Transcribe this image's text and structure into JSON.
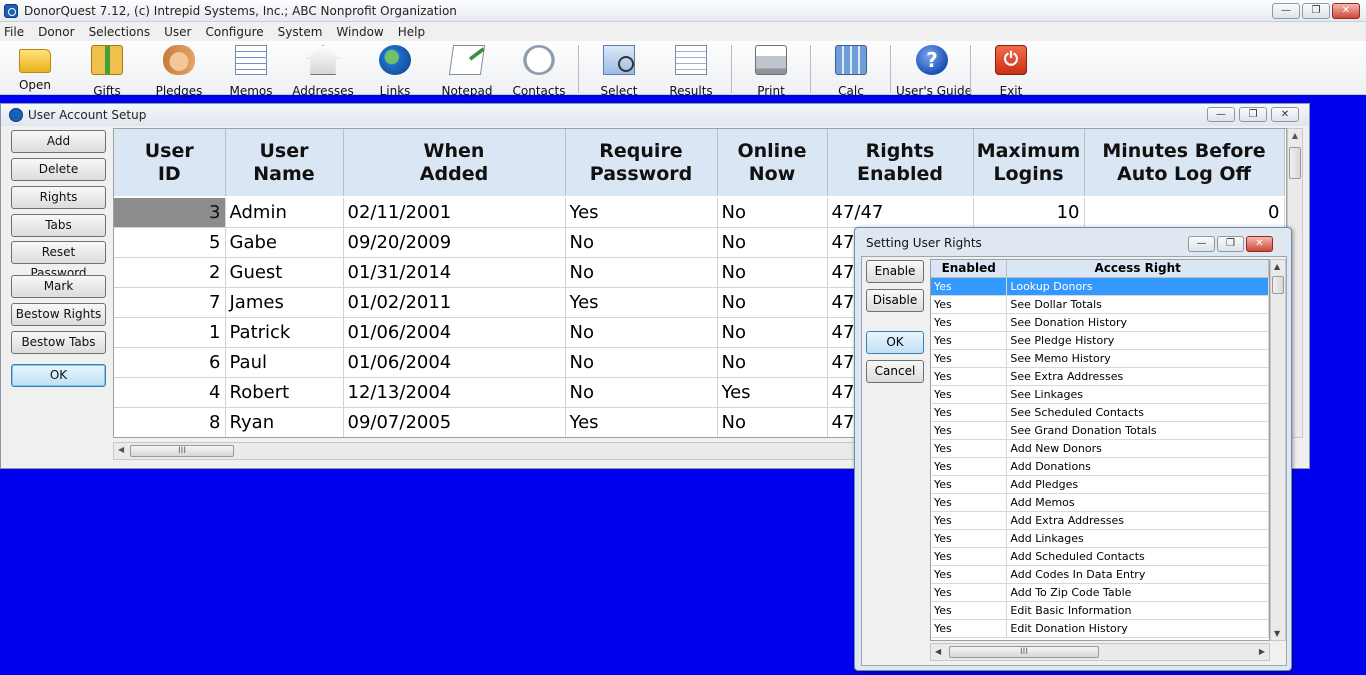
{
  "app": {
    "title": "DonorQuest 7.12, (c) Intrepid Systems, Inc.; ABC Nonprofit Organization",
    "window_buttons": [
      "—",
      "❐",
      "✕"
    ]
  },
  "menu": [
    "File",
    "Donor",
    "Selections",
    "User",
    "Configure",
    "System",
    "Window",
    "Help"
  ],
  "toolbar": [
    {
      "label": "Open",
      "icon": "folder-icon"
    },
    {
      "label": "Gifts",
      "icon": "gift-icon"
    },
    {
      "label": "Pledges",
      "icon": "handshake-icon"
    },
    {
      "label": "Memos",
      "icon": "memo-icon"
    },
    {
      "label": "Addresses",
      "icon": "house-icon"
    },
    {
      "label": "Links",
      "icon": "globe-icon"
    },
    {
      "label": "Notepad",
      "icon": "notepad-icon"
    },
    {
      "label": "Contacts",
      "icon": "clock-icon"
    },
    {
      "label": "Select",
      "icon": "magnifier-icon"
    },
    {
      "label": "Results",
      "icon": "results-icon"
    },
    {
      "label": "Print",
      "icon": "printer-icon"
    },
    {
      "label": "Calc",
      "icon": "calculator-icon"
    },
    {
      "label": "User's Guide",
      "icon": "help-icon"
    },
    {
      "label": "Exit",
      "icon": "exit-icon"
    }
  ],
  "user_account_setup": {
    "title": "User Account Setup",
    "buttons": [
      "Add",
      "Delete",
      "Rights",
      "Tabs",
      "Reset Password",
      "Mark",
      "Bestow Rights",
      "Bestow Tabs",
      "OK"
    ],
    "columns": [
      "User\nID",
      "User\nName",
      "When\nAdded",
      "Require\nPassword",
      "Online\nNow",
      "Rights\nEnabled",
      "Maximum\nLogins",
      "Minutes Before\nAuto Log Off"
    ],
    "rows": [
      [
        "3",
        "Admin",
        "02/11/2001",
        "Yes",
        "No",
        "47/47",
        "10",
        "0"
      ],
      [
        "5",
        "Gabe",
        "09/20/2009",
        "No",
        "No",
        "47/",
        "",
        ""
      ],
      [
        "2",
        "Guest",
        "01/31/2014",
        "No",
        "No",
        "47/",
        "",
        ""
      ],
      [
        "7",
        "James",
        "01/02/2011",
        "Yes",
        "No",
        "47/",
        "",
        ""
      ],
      [
        "1",
        "Patrick",
        "01/06/2004",
        "No",
        "No",
        "47/",
        "",
        ""
      ],
      [
        "6",
        "Paul",
        "01/06/2004",
        "No",
        "No",
        "47/",
        "",
        ""
      ],
      [
        "4",
        "Robert",
        "12/13/2004",
        "No",
        "Yes",
        "47/",
        "",
        ""
      ],
      [
        "8",
        "Ryan",
        "09/07/2005",
        "Yes",
        "No",
        "47/",
        "",
        ""
      ]
    ],
    "scroll_thumb": "III"
  },
  "rights_dialog": {
    "title": "Setting User Rights",
    "buttons": [
      "Enable",
      "Disable",
      "OK",
      "Cancel"
    ],
    "columns": [
      "Enabled",
      "Access Right"
    ],
    "rows": [
      [
        "Yes",
        "Lookup Donors"
      ],
      [
        "Yes",
        "See Dollar Totals"
      ],
      [
        "Yes",
        "See Donation History"
      ],
      [
        "Yes",
        "See Pledge History"
      ],
      [
        "Yes",
        "See Memo History"
      ],
      [
        "Yes",
        "See Extra Addresses"
      ],
      [
        "Yes",
        "See Linkages"
      ],
      [
        "Yes",
        "See Scheduled Contacts"
      ],
      [
        "Yes",
        "See Grand Donation Totals"
      ],
      [
        "Yes",
        "Add New Donors"
      ],
      [
        "Yes",
        "Add Donations"
      ],
      [
        "Yes",
        "Add Pledges"
      ],
      [
        "Yes",
        "Add Memos"
      ],
      [
        "Yes",
        "Add Extra Addresses"
      ],
      [
        "Yes",
        "Add Linkages"
      ],
      [
        "Yes",
        "Add Scheduled Contacts"
      ],
      [
        "Yes",
        "Add Codes In Data Entry"
      ],
      [
        "Yes",
        "Add To Zip Code Table"
      ],
      [
        "Yes",
        "Edit Basic Information"
      ],
      [
        "Yes",
        "Edit Donation History"
      ]
    ],
    "selected_row": 0,
    "scroll_thumb": "III"
  }
}
